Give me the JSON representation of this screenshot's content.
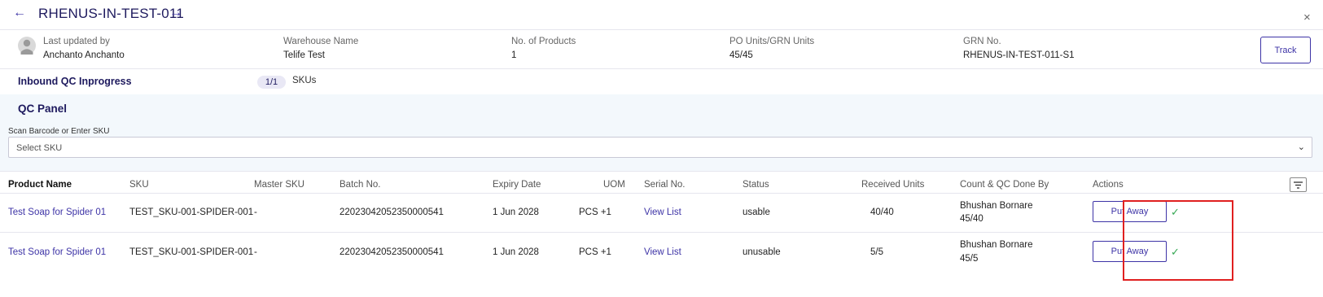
{
  "header": {
    "back_arrow": "←",
    "forward_arrow": "→",
    "title": "RHENUS-IN-TEST-011",
    "close": "×"
  },
  "meta": {
    "last_updated_label": "Last updated by",
    "last_updated_value": "Anchanto Anchanto",
    "warehouse_label": "Warehouse Name",
    "warehouse_value": "Telife Test",
    "products_label": "No. of Products",
    "products_value": "1",
    "po_units_label": "PO Units/GRN Units",
    "po_units_value": "45/45",
    "grn_label": "GRN No.",
    "grn_value": "RHENUS-IN-TEST-011-S1",
    "track_label": "Track"
  },
  "status_bar": {
    "label": "Inbound QC Inprogress",
    "counter": "1/1",
    "unit": "SKUs"
  },
  "qc_panel": {
    "title": "QC Panel",
    "scan_label": "Scan Barcode or Enter SKU",
    "select_placeholder": "Select SKU",
    "chevron": "⌄"
  },
  "table": {
    "columns": {
      "product_name": "Product Name",
      "sku": "SKU",
      "master_sku": "Master SKU",
      "batch": "Batch No.",
      "expiry": "Expiry Date",
      "uom": "UOM",
      "serial": "Serial No.",
      "status": "Status",
      "received": "Received Units",
      "count_qc": "Count & QC Done By",
      "actions": "Actions"
    },
    "rows": [
      {
        "product_name": "Test Soap for Spider 01",
        "sku": "TEST_SKU-001-SPIDER-001",
        "master_sku": "-",
        "batch": "22023042052350000541",
        "expiry": "1 Jun 2028",
        "uom": "PCS +1",
        "serial": "View List",
        "status": "usable",
        "received": "40/40",
        "qc_by": "Bhushan Bornare",
        "qc_count": "45/40",
        "action": "Put Away",
        "check": "✓"
      },
      {
        "product_name": "Test Soap for Spider 01",
        "sku": "TEST_SKU-001-SPIDER-001",
        "master_sku": "-",
        "batch": "22023042052350000541",
        "expiry": "1 Jun 2028",
        "uom": "PCS +1",
        "serial": "View List",
        "status": "unusable",
        "received": "5/5",
        "qc_by": "Bhushan Bornare",
        "qc_count": "45/5",
        "action": "Put Away",
        "check": "✓"
      }
    ]
  },
  "colors": {
    "brand": "#3d33a6",
    "title": "#1e1a5e",
    "panel_bg": "#f3f8fc",
    "success": "#35a853",
    "highlight": "#e02020"
  },
  "icons": {
    "back": "arrow-left-icon",
    "forward": "arrow-right-icon",
    "close": "close-icon",
    "avatar": "user-avatar-icon",
    "filter": "filter-icon",
    "check": "check-icon",
    "chevron": "chevron-down-icon"
  }
}
